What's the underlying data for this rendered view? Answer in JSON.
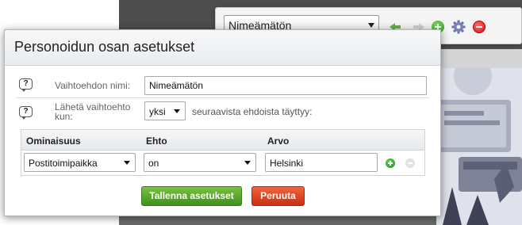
{
  "background": {
    "toolbar": {
      "selected_variant": "Nimeämätön",
      "icons": [
        "back-arrow-icon",
        "forward-arrow-icon",
        "add-icon",
        "settings-gear-icon",
        "remove-icon"
      ]
    }
  },
  "dialog": {
    "title": "Personoidun osan asetukset",
    "variant_name_label": "Vaihtoehdon nimi:",
    "variant_name_value": "Nimeämätön",
    "show_when_label": "Lähetä vaihtoehto kun:",
    "match_mode_value": "yksi",
    "match_suffix": "seuraavista ehdoista täyttyy:",
    "table": {
      "headers": {
        "property": "Ominaisuus",
        "condition": "Ehto",
        "value": "Arvo"
      },
      "rows": [
        {
          "property": "Postitoimipaikka",
          "condition": "on",
          "value": "Helsinki"
        }
      ]
    },
    "save_label": "Tallenna asetukset",
    "cancel_label": "Peruuta"
  },
  "colors": {
    "save_button": "#5aa52f",
    "cancel_button": "#de4a26",
    "add_icon": "#2f9a2a",
    "remove_icon": "#d11616"
  }
}
